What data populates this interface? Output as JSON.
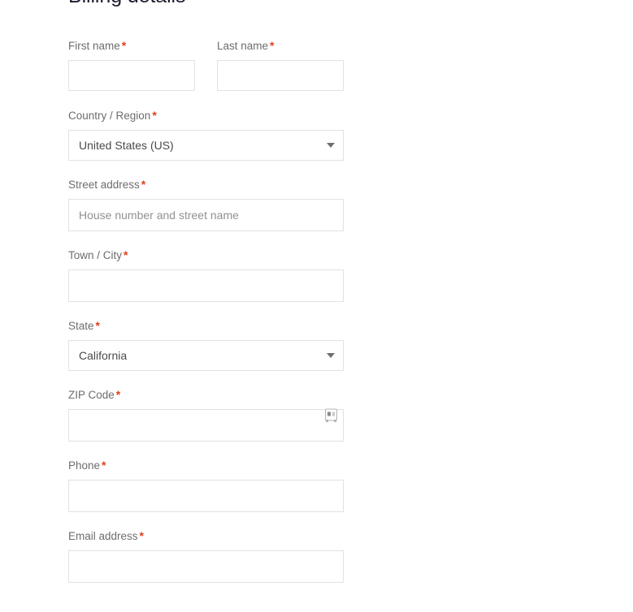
{
  "page": {
    "title": "Billing details",
    "background_color": "#ffffff",
    "required_marker": "*",
    "required_color": "#e2401c",
    "label_color": "#6d6d6d",
    "border_color": "#e1e1e7"
  },
  "form": {
    "fields": [
      {
        "key": "first_name",
        "label": "First name",
        "required": true,
        "type": "text",
        "value": "",
        "placeholder": ""
      },
      {
        "key": "last_name",
        "label": "Last name",
        "required": true,
        "type": "text",
        "value": "",
        "placeholder": ""
      },
      {
        "key": "country",
        "label": "Country / Region",
        "required": true,
        "type": "select",
        "value": "United States (US)",
        "icon": "chevron-down-icon"
      },
      {
        "key": "street_address",
        "label": "Street address",
        "required": true,
        "type": "text",
        "value": "",
        "placeholder": "House number and street name"
      },
      {
        "key": "city",
        "label": "Town / City",
        "required": true,
        "type": "text",
        "value": "",
        "placeholder": ""
      },
      {
        "key": "state",
        "label": "State",
        "required": true,
        "type": "select",
        "value": "California",
        "icon": "chevron-down-icon"
      },
      {
        "key": "zip",
        "label": "ZIP Code",
        "required": true,
        "type": "text",
        "value": "",
        "placeholder": "",
        "icon": "autofill-icon"
      },
      {
        "key": "phone",
        "label": "Phone",
        "required": true,
        "type": "tel",
        "value": "",
        "placeholder": ""
      },
      {
        "key": "email",
        "label": "Email address",
        "required": true,
        "type": "email",
        "value": "",
        "placeholder": ""
      }
    ]
  }
}
